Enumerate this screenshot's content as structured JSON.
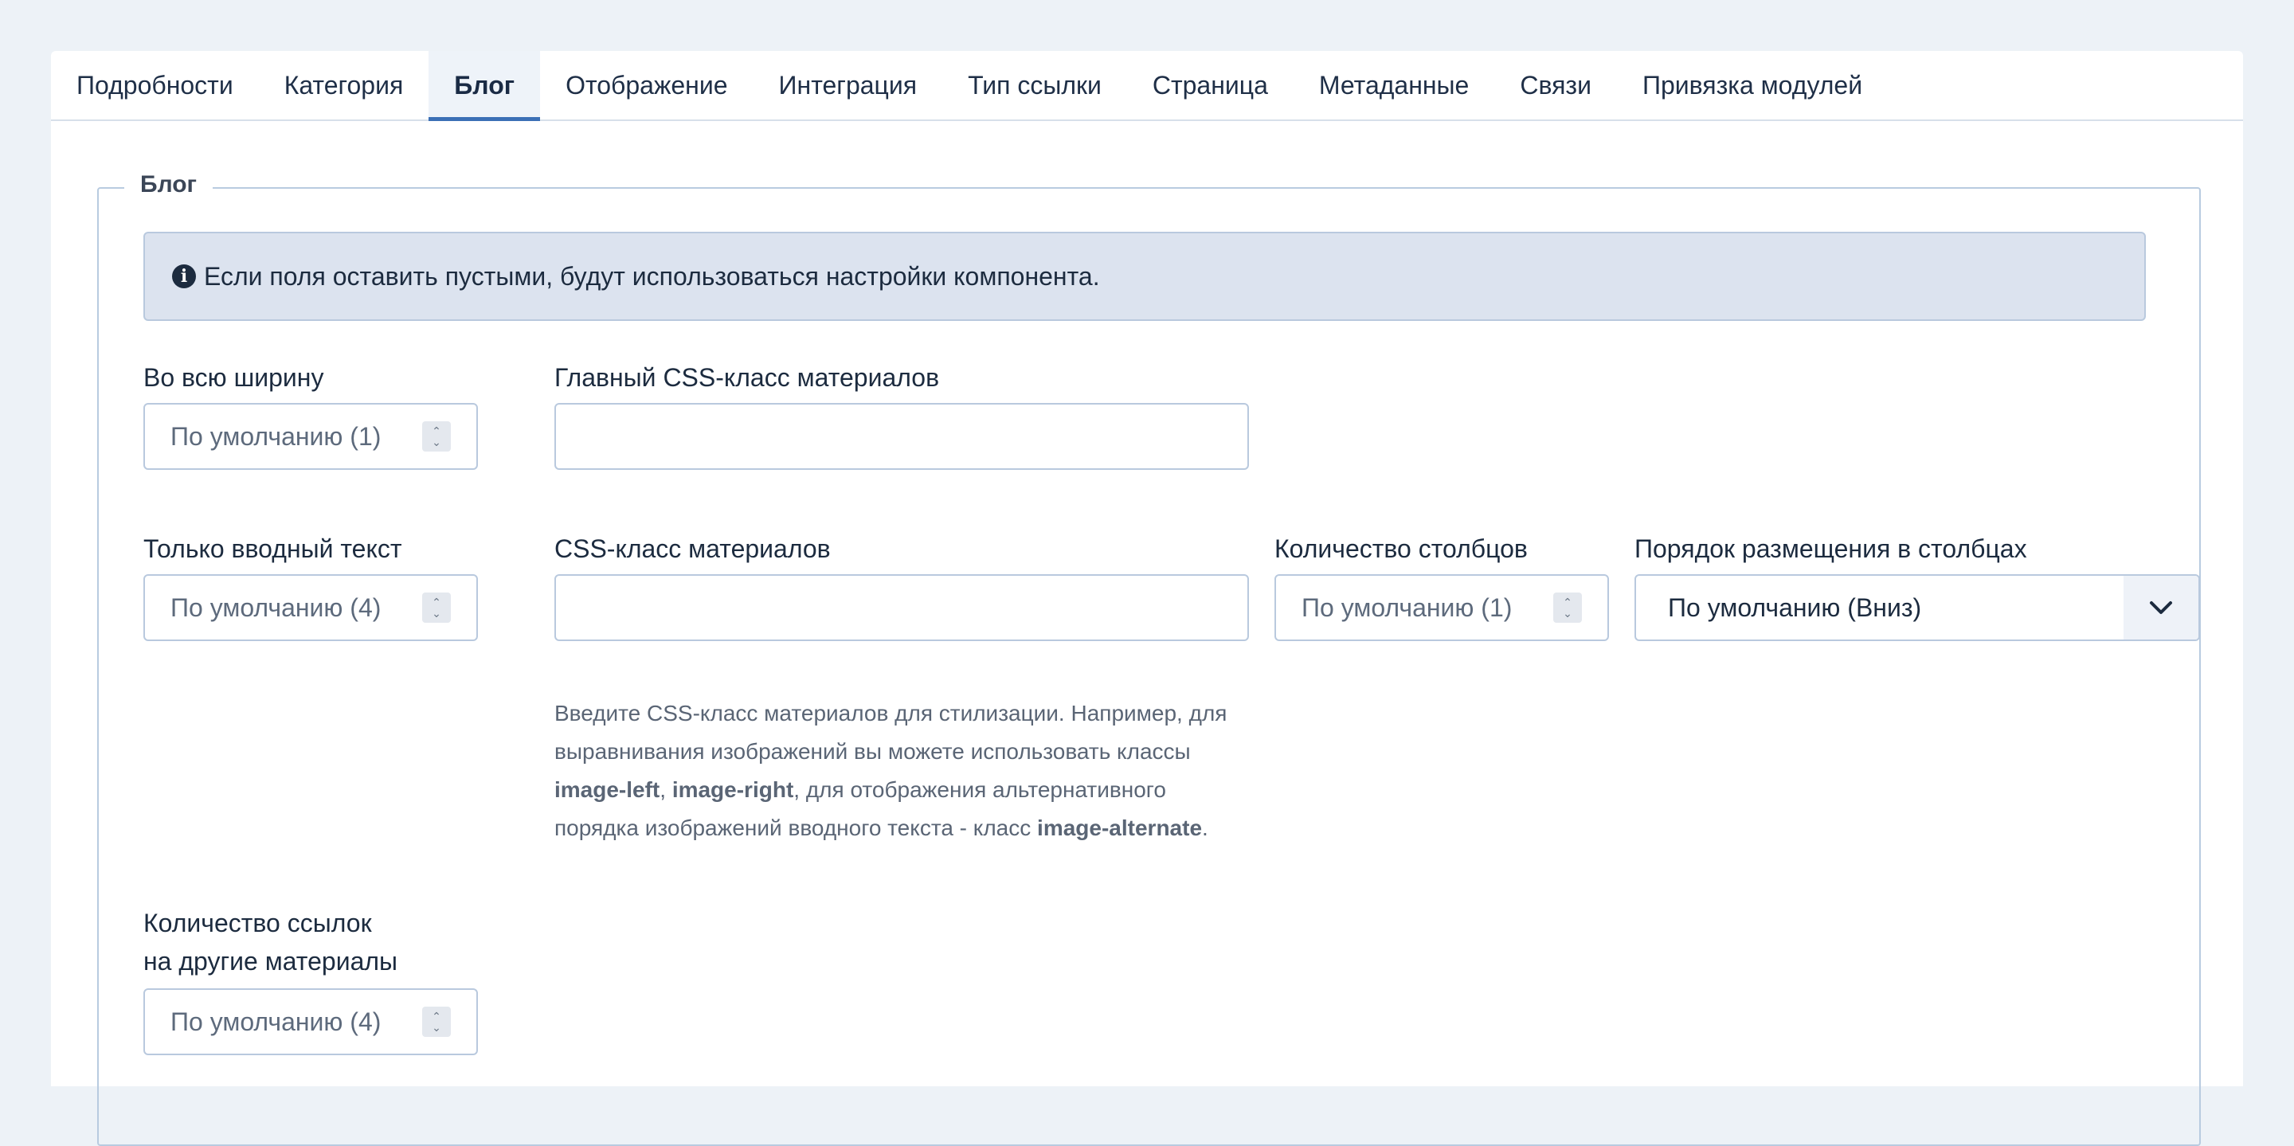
{
  "tabs": [
    {
      "label": "Подробности",
      "active": false
    },
    {
      "label": "Категория",
      "active": false
    },
    {
      "label": "Блог",
      "active": true
    },
    {
      "label": "Отображение",
      "active": false
    },
    {
      "label": "Интеграция",
      "active": false
    },
    {
      "label": "Тип ссылки",
      "active": false
    },
    {
      "label": "Страница",
      "active": false
    },
    {
      "label": "Метаданные",
      "active": false
    },
    {
      "label": "Связи",
      "active": false
    },
    {
      "label": "Привязка модулей",
      "active": false
    }
  ],
  "fieldset": {
    "legend": "Блог"
  },
  "alert": {
    "icon": "info-circle-icon",
    "text": "Если поля оставить пустыми, будут использоваться настройки компонента."
  },
  "fields": {
    "full_width": {
      "label": "Во всю ширину",
      "value": "По умолчанию (1)"
    },
    "main_css": {
      "label": "Главный CSS-класс материалов",
      "value": ""
    },
    "intro_only": {
      "label": "Только вводный текст",
      "value": "По умолчанию (4)"
    },
    "css_class": {
      "label": "CSS-класс материалов",
      "value": "",
      "help_parts": [
        "Введите CSS-класс материалов для стилизации. Например, для выравнивания изображений вы можете использовать классы ",
        "image-left",
        ", ",
        "image-right",
        ", для отображения альтернативного порядка изображений вводного текста - класс ",
        "image-alternate",
        "."
      ]
    },
    "columns": {
      "label": "Количество столбцов",
      "value": "По умолчанию (1)"
    },
    "column_order": {
      "label": "Порядок размещения в столбцах",
      "value": "По умолчанию (Вниз)"
    },
    "links_count": {
      "label_line1": "Количество ссылок",
      "label_line2": "на другие материалы",
      "value": "По умолчанию (4)"
    }
  },
  "colors": {
    "active_tab_underline": "#3b6fb6",
    "alert_bg": "#dce3ef",
    "page_bg": "#edf2f7"
  }
}
